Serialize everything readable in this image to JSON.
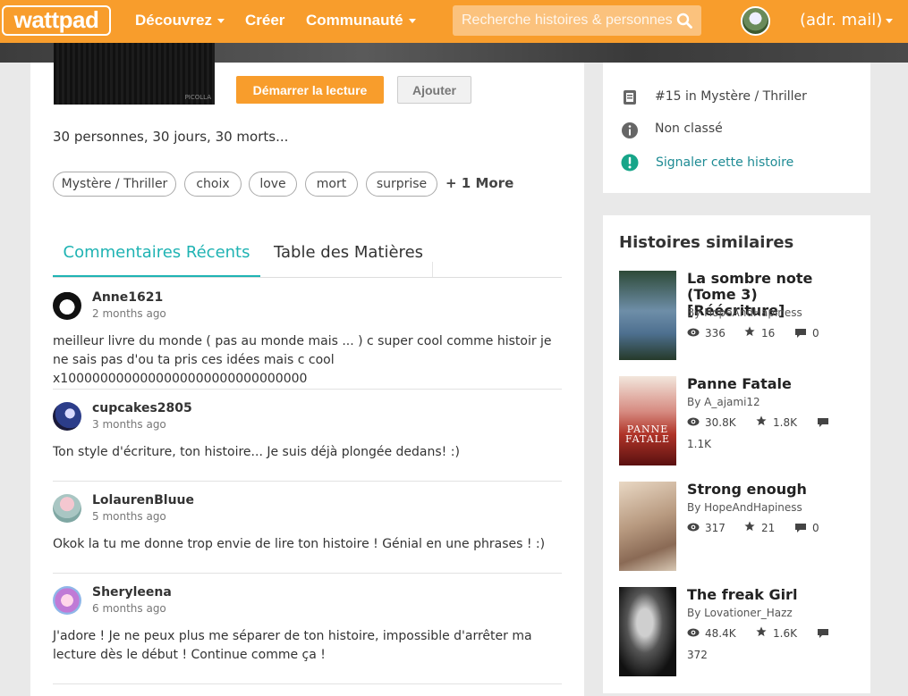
{
  "header": {
    "logo": "wattpad",
    "nav_discover": "Découvrez",
    "nav_create": "Créer",
    "nav_community": "Communauté",
    "search_placeholder": "Recherche histoires & personnes",
    "user_label": "(adr. mail)"
  },
  "story": {
    "cover_signature": "PICOLLA",
    "read_button": "Démarrer la lecture",
    "add_button": "Ajouter",
    "description": "30 personnes, 30 jours, 30 morts...",
    "tags": [
      "Mystère / Thriller",
      "choix",
      "love",
      "mort",
      "surprise"
    ],
    "more_tags": "+ 1 More"
  },
  "tabs": {
    "recent_comments": "Commentaires Récents",
    "table_of_contents": "Table des Matières"
  },
  "comments": [
    {
      "user": "Anne1621",
      "time": "2 months ago",
      "text": "meilleur livre du monde ( pas au monde mais ... ) c super cool comme histoir je ne sais pas d'ou ta pris ces idées mais c cool x1000000000000000000000000000000"
    },
    {
      "user": "cupcakes2805",
      "time": "3 months ago",
      "text": "Ton style d'écriture, ton histoire... Je suis déjà plongée dedans! :)"
    },
    {
      "user": "LolaurenBluue",
      "time": "5 months ago",
      "text": "Okok la tu me donne trop envie de lire ton histoire ! Génial en une phrases ! :)"
    },
    {
      "user": "Sheryleena",
      "time": "6 months ago",
      "text": "J'adore ! Je ne peux plus me séparer de ton histoire, impossible d'arrêter ma lecture dès le début ! Continue comme ça  !"
    }
  ],
  "sidebar": {
    "rank": "#15 in Mystère / Thriller",
    "rating": "Non classé",
    "report": "Signaler cette histoire",
    "similar_title": "Histoires similaires",
    "similar": [
      {
        "title": "La sombre note (Tome 3) [Réécriture]",
        "by": "By HopeAndHapiness",
        "reads": "336",
        "votes": "16",
        "comments": "0"
      },
      {
        "title": "Panne Fatale",
        "by": "By A_ajami12",
        "reads": "30.8K",
        "votes": "1.8K",
        "comments": "1.1K",
        "cover_text": "PANNE FATALE"
      },
      {
        "title": "Strong enough",
        "by": "By HopeAndHapiness",
        "reads": "317",
        "votes": "21",
        "comments": "0"
      },
      {
        "title": "The freak Girl",
        "by": "By Lovationer_Hazz",
        "reads": "48.4K",
        "votes": "1.6K",
        "comments": "372"
      }
    ]
  },
  "colors": {
    "brand": "#f89d2c",
    "accent": "#1fb3b3",
    "link": "#1e8b94"
  },
  "icons": {
    "search": "search-icon",
    "rank": "book-icon",
    "rating": "info-icon",
    "report": "alert-icon",
    "reads": "eye-icon",
    "votes": "star-icon",
    "comments": "comment-icon"
  }
}
